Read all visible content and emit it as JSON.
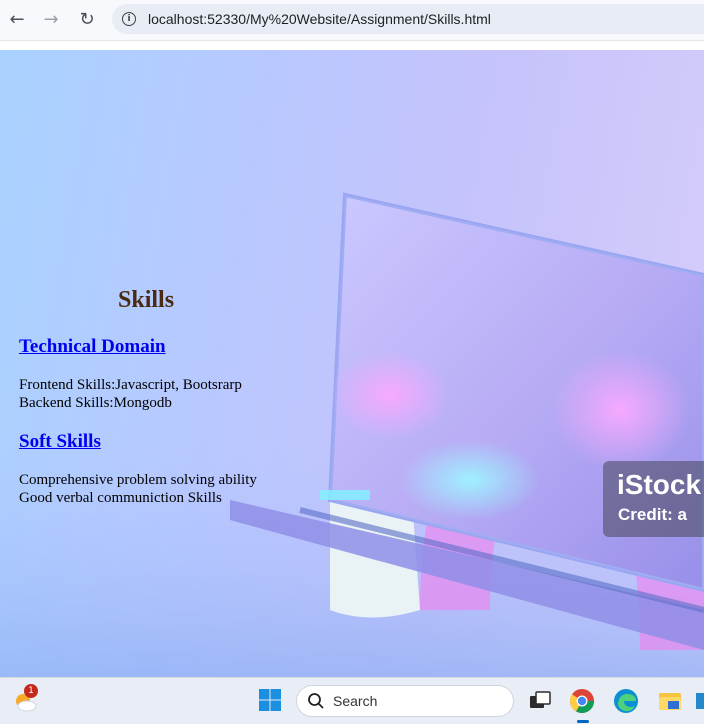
{
  "browser": {
    "back_icon": "←",
    "forward_icon": "→",
    "reload_icon": "↻",
    "info_icon": "i",
    "url": "localhost:52330/My%20Website/Assignment/Skills.html"
  },
  "page": {
    "title": "Skills",
    "technical": {
      "heading": "Technical Domain",
      "lines": [
        "Frontend Skills:Javascript, Bootsrarp",
        "Backend Skills:Mongodb"
      ]
    },
    "soft": {
      "heading": "Soft Skills",
      "lines": [
        "Comprehensive problem solving ability",
        "Good verbal communiction Skills"
      ]
    },
    "watermark": {
      "brand": "iStock",
      "credit": "Credit: a"
    }
  },
  "taskbar": {
    "notification_count": "1",
    "search_label": "Search"
  },
  "colors": {
    "title": "#4a2a10",
    "link": "#0000ee",
    "accent": "#0067c0"
  }
}
